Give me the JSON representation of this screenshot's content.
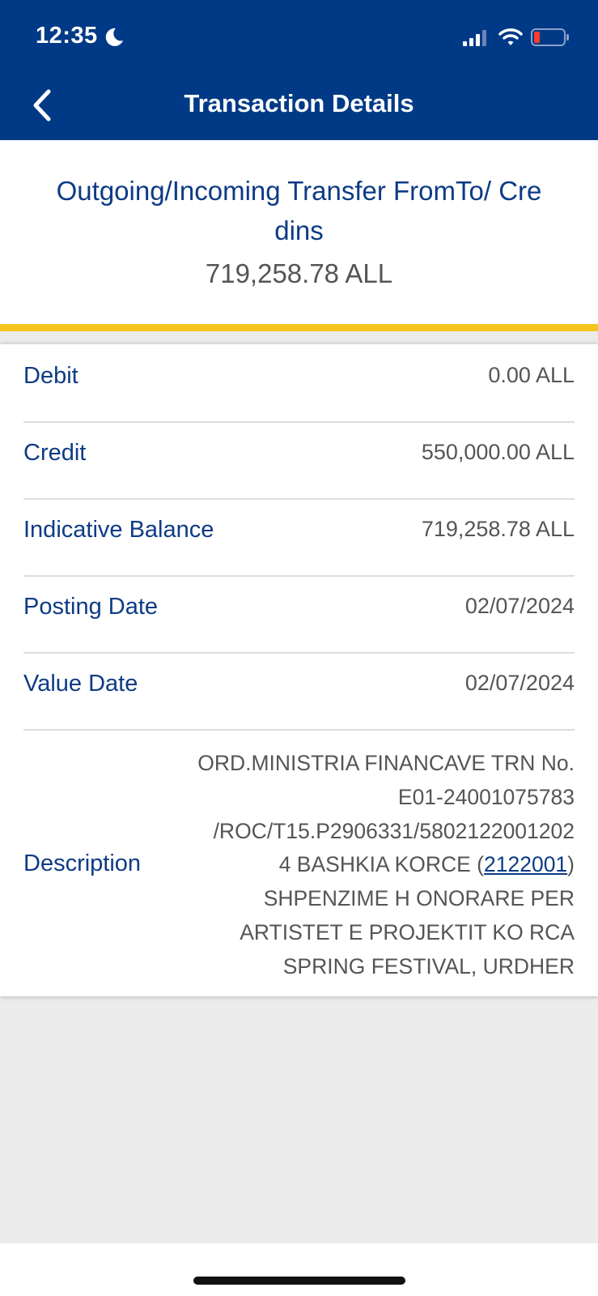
{
  "status_bar": {
    "time": "12:35"
  },
  "header": {
    "title": "Transaction Details"
  },
  "summary": {
    "title_line1": "Outgoing/Incoming Transfer FromTo/ Cre",
    "title_line2": "dins",
    "amount": "719,258.78 ALL"
  },
  "details": [
    {
      "label": "Debit",
      "value": "0.00 ALL"
    },
    {
      "label": "Credit",
      "value": "550,000.00 ALL"
    },
    {
      "label": "Indicative Balance",
      "value": "719,258.78 ALL"
    },
    {
      "label": "Posting Date",
      "value": "02/07/2024"
    },
    {
      "label": "Value Date",
      "value": "02/07/2024"
    }
  ],
  "description": {
    "label": "Description",
    "line1": "ORD.MINISTRIA FINANCAVE TRN No.",
    "line2": "E01-24001075783",
    "line3": "/ROC/T15.P2906331/5802122001202",
    "line4_prefix": "4 BASHKIA KORCE (",
    "line4_link": "2122001",
    "line4_suffix": ")",
    "line5": "SHPENZIME H ONORARE PER",
    "line6": "ARTISTET E PROJEKTIT KO RCA",
    "line7": "SPRING FESTIVAL, URDHER"
  },
  "colors": {
    "header": "#003a86",
    "accent": "#f6c51d",
    "label": "#0d3b85"
  }
}
